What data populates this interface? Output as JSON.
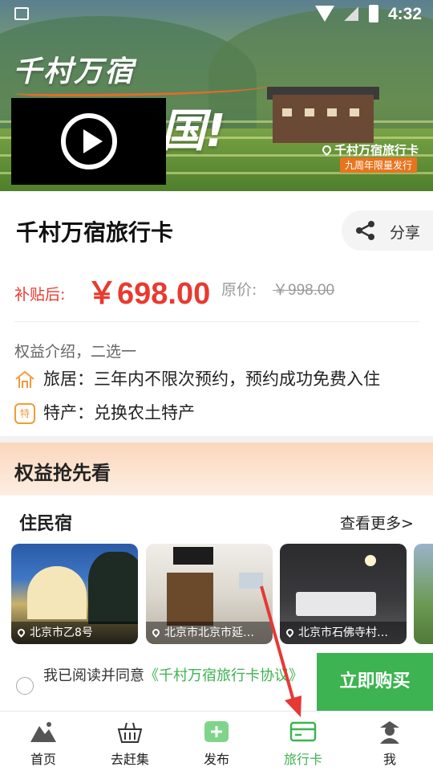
{
  "status_bar": {
    "time": "4:32"
  },
  "hero": {
    "logo": "千村万宿",
    "slogan_fragment": "国!",
    "tag": "千村万宿旅行卡",
    "badge": "九周年限量发行"
  },
  "product": {
    "title": "千村万宿旅行卡",
    "share_label": "分享",
    "subsidy_prefix": "补贴后:",
    "price": "￥698.00",
    "original_label": "原价:",
    "original_price": "￥998.00"
  },
  "benefits": {
    "heading": "权益介绍，二选一",
    "items": [
      {
        "label": "旅居：三年内不限次预约，预约成功免费入住",
        "icon": "house-icon"
      },
      {
        "label": "特产：兑换农土特产",
        "icon": "specialty-icon",
        "icon_text": "特"
      }
    ]
  },
  "section": {
    "title": "权益抢先看",
    "sub_title": "住民宿",
    "more": "查看更多>",
    "cards": [
      {
        "location": "北京市乙8号"
      },
      {
        "location": "北京市北京市延…"
      },
      {
        "location": "北京市石佛寺村…"
      }
    ]
  },
  "agreement": {
    "text": "我已阅读并同意",
    "link": "《千村万宿旅行卡协议》",
    "buy_label": "立即购买"
  },
  "nav": {
    "items": [
      {
        "label": "首页",
        "icon": "home-icon"
      },
      {
        "label": "去赶集",
        "icon": "basket-icon"
      },
      {
        "label": "发布",
        "icon": "plus-icon"
      },
      {
        "label": "旅行卡",
        "icon": "card-icon",
        "active": true
      },
      {
        "label": "我",
        "icon": "profile-icon"
      }
    ]
  },
  "colors": {
    "accent_green": "#3db351",
    "price_red": "#e83a2f",
    "orange": "#f39a3a"
  }
}
